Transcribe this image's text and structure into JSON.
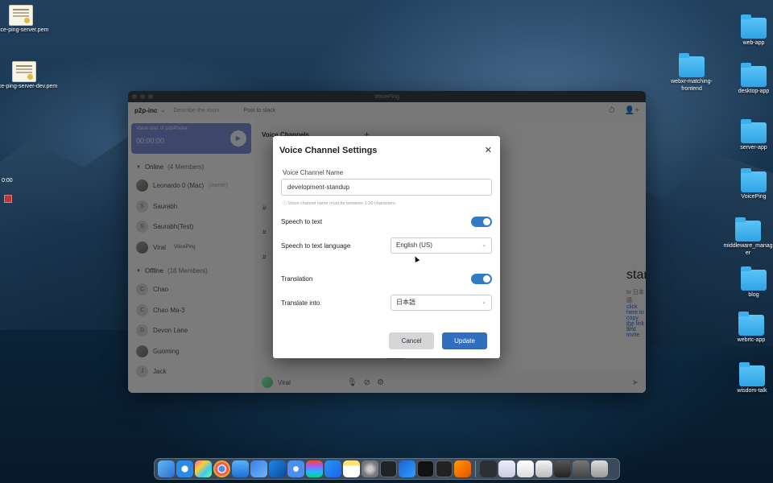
{
  "desktop": {
    "left_files": [
      {
        "label": "voice-ping-server.pem",
        "icon": "certificate-icon"
      },
      {
        "label": "voice-ping-server-dev.pem",
        "icon": "certificate-icon"
      }
    ],
    "recording_time": "0:00",
    "right_folders": [
      {
        "label": "web-app"
      },
      {
        "label": "webxr-matching-frontend"
      },
      {
        "label": "desktop-app"
      },
      {
        "label": "server-app"
      },
      {
        "label": "VoicePing"
      },
      {
        "label": "middleware_manager"
      },
      {
        "label": "blog"
      },
      {
        "label": "webrtc-app"
      },
      {
        "label": "wisdom-talk"
      }
    ]
  },
  "app": {
    "window_title": "VoicePing",
    "team": "p2p-inc",
    "describe_placeholder": "Describe the room",
    "post_link": "Post to slack",
    "live_card": {
      "caption": "Voice user of p2pPhone",
      "time": "00:00:00"
    },
    "online": {
      "title": "Online",
      "count": "(4 Members)"
    },
    "online_members": [
      {
        "name": "Leonardo 0 (Mac)",
        "sub": "(owner)",
        "avatar": ""
      },
      {
        "name": "Saurabh",
        "sub": "",
        "avatar": "S"
      },
      {
        "name": "Saurabh(Test)",
        "sub": "",
        "avatar": "S"
      },
      {
        "name": "Viral",
        "sub": "VoicePing",
        "avatar": ""
      }
    ],
    "offline": {
      "title": "Offline",
      "count": "(18 Members)"
    },
    "offline_members": [
      {
        "name": "Chao",
        "avatar": "C"
      },
      {
        "name": "Chao Ma-3",
        "avatar": "C"
      },
      {
        "name": "Devon Lane",
        "avatar": "D"
      },
      {
        "name": "Guoming",
        "avatar": ""
      },
      {
        "name": "Jack",
        "avatar": "J"
      }
    ],
    "channels_header": "Voice Channels",
    "background_title": "standup",
    "background_line_a": "to 日本語.",
    "background_link": "click here to copy the link and invite",
    "background_small": "pm",
    "current_user": "Viral"
  },
  "modal": {
    "title": "Voice Channel Settings",
    "name_label": "Voice Channel Name",
    "name_value": "development-standup",
    "name_hint": "Voice channel name must be between 1-30 characters.",
    "speech_to_text_label": "Speech to text",
    "speech_to_text_on": true,
    "language_label": "Speech to text language",
    "language_value": "English (US)",
    "translation_label": "Translation",
    "translation_on": true,
    "translate_into_label": "Translate into",
    "translate_into_value": "日本語",
    "cancel_label": "Cancel",
    "update_label": "Update",
    "accent_color": "#2f6fbd"
  },
  "dock": {
    "icons": [
      "finder-icon",
      "safari-icon",
      "launchpad-icon",
      "chrome-icon",
      "mail-icon",
      "cube-icon",
      "vscode-icon",
      "settings-icon",
      "figma-icon",
      "docker-icon",
      "notes-icon",
      "system-preferences-icon",
      "activity-icon",
      "xcode-icon",
      "terminal-icon",
      "terminal-icon-2",
      "sublime-icon",
      "downloads-icon",
      "preview-icon",
      "screenshot-icon",
      "window-icon",
      "window-icon-2",
      "window-icon-3",
      "trash-icon"
    ]
  }
}
